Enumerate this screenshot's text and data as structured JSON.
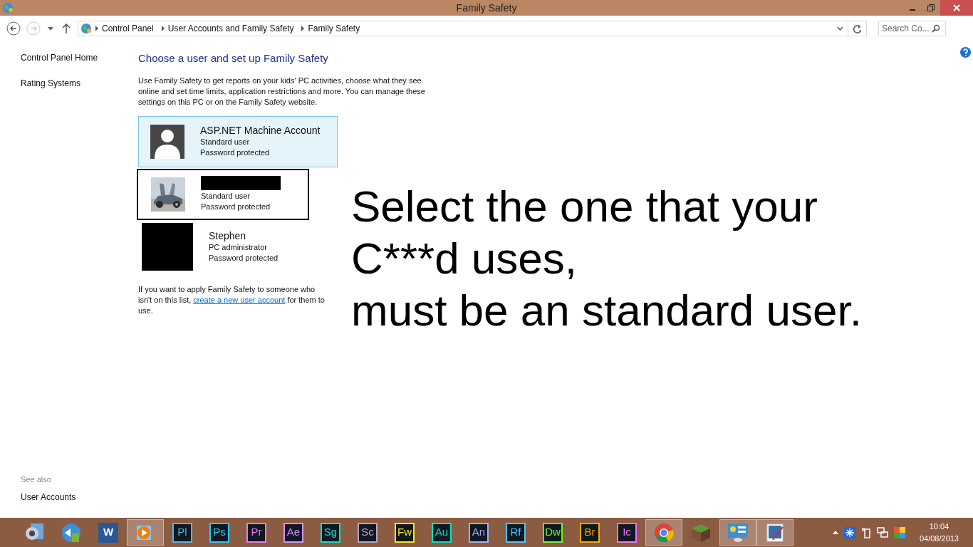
{
  "window": {
    "title": "Family Safety"
  },
  "address_bar": {
    "breadcrumbs": [
      "Control Panel",
      "User Accounts and Family Safety",
      "Family Safety"
    ],
    "search_placeholder": "Search Co..."
  },
  "sidebar": {
    "items": [
      "Control Panel Home",
      "Rating Systems"
    ],
    "see_also_heading": "See also",
    "see_also_items": [
      "User Accounts"
    ]
  },
  "content": {
    "heading": "Choose a user and set up Family Safety",
    "intro": "Use Family Safety to get reports on your kids' PC activities, choose what they see online and set time limits, application restrictions and more. You can manage these settings on this PC or on the Family Safety website.",
    "users": [
      {
        "kind": "default",
        "name": "ASP.NET Machine Account",
        "name_redacted": false,
        "role": "Standard user",
        "password": "Password protected",
        "selected": true,
        "outlined": false
      },
      {
        "kind": "picture",
        "name_redacted": true,
        "role": "Standard user",
        "password": "Password protected",
        "selected": false,
        "outlined": true
      },
      {
        "kind": "redacted",
        "name": "Stephen",
        "name_redacted": false,
        "role": "PC administrator",
        "password": "Password protected",
        "selected": false,
        "outlined": false
      }
    ],
    "footer_text": "If you want to apply Family Safety to someone who isn't on this list, ",
    "footer_link": "create a new user account",
    "footer_end": " for them to use."
  },
  "annotation": [
    "Select the one that your",
    "C***d uses,",
    "must be an standard user."
  ],
  "taskbar": {
    "apps": [
      {
        "kind": "camera",
        "active": false
      },
      {
        "kind": "sync",
        "active": false
      },
      {
        "kind": "word",
        "label": "W",
        "active": false
      },
      {
        "kind": "player",
        "active": true
      },
      {
        "kind": "tile",
        "label": "Pl",
        "color": "#4fb7e8",
        "active": false
      },
      {
        "kind": "tile",
        "label": "Ps",
        "color": "#31c5f0",
        "active": false
      },
      {
        "kind": "tile",
        "label": "Pr",
        "color": "#ea77ff",
        "active": false
      },
      {
        "kind": "tile",
        "label": "Ae",
        "color": "#d291ff",
        "active": false
      },
      {
        "kind": "tile",
        "label": "Sg",
        "color": "#00e4d6",
        "active": false
      },
      {
        "kind": "tile",
        "label": "Sc",
        "color": "#b9a4c9",
        "active": false
      },
      {
        "kind": "tile",
        "label": "Fw",
        "color": "#f6e80e",
        "active": false
      },
      {
        "kind": "tile",
        "label": "Au",
        "color": "#00e4bb",
        "active": false
      },
      {
        "kind": "tile",
        "label": "An",
        "color": "#a9a9ff",
        "active": false
      },
      {
        "kind": "tile",
        "label": "Rf",
        "color": "#4ec2ff",
        "active": false
      },
      {
        "kind": "tile",
        "label": "Dw",
        "color": "#5eff24",
        "active": false
      },
      {
        "kind": "tile",
        "label": "Br",
        "color": "#ffa700",
        "active": false
      },
      {
        "kind": "tile",
        "label": "Ic",
        "color": "#f86dff",
        "active": false
      },
      {
        "kind": "chrome",
        "active": true
      },
      {
        "kind": "grass",
        "active": false
      },
      {
        "kind": "panel",
        "active": true
      },
      {
        "kind": "paint",
        "active": true
      }
    ],
    "time": "10:04",
    "date": "04/08/2013"
  }
}
